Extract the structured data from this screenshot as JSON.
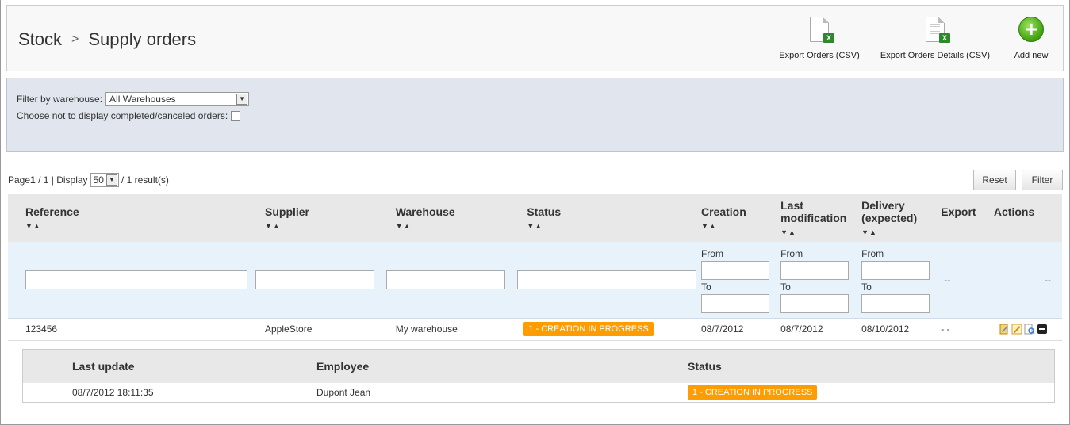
{
  "breadcrumb": {
    "parent": "Stock",
    "separator": ">",
    "current": "Supply orders"
  },
  "toolbar": {
    "export_orders": "Export Orders (CSV)",
    "export_details": "Export Orders Details (CSV)",
    "add_new": "Add new"
  },
  "filters": {
    "warehouse_label": "Filter by warehouse:",
    "warehouse_value": "All Warehouses",
    "hide_completed_label": "Choose not to display completed/canceled orders:"
  },
  "pagination": {
    "page_prefix": "Page",
    "current_page": "1",
    "page_suffix": "/ 1 | Display",
    "per_page": "50",
    "results": "/ 1 result(s)"
  },
  "buttons": {
    "reset": "Reset",
    "filter": "Filter"
  },
  "table": {
    "columns": {
      "reference": "Reference",
      "supplier": "Supplier",
      "warehouse": "Warehouse",
      "status": "Status",
      "creation": "Creation",
      "last_modification_1": "Last",
      "last_modification_2": "modification",
      "delivery_1": "Delivery",
      "delivery_2": "(expected)",
      "export": "Export",
      "actions": "Actions"
    },
    "sort_glyph": "▼▲",
    "date_from": "From",
    "date_to": "To",
    "empty_filter": "--",
    "row": {
      "reference": "123456",
      "supplier": "AppleStore",
      "warehouse": "My warehouse",
      "status": "1 - CREATION IN PROGRESS",
      "creation": "08/7/2012",
      "last_modification": "08/7/2012",
      "delivery": "08/10/2012",
      "export": "- -"
    }
  },
  "history": {
    "columns": {
      "last_update": "Last update",
      "employee": "Employee",
      "status": "Status"
    },
    "row": {
      "last_update": "08/7/2012 18:11:35",
      "employee": "Dupont Jean",
      "status": "1 - CREATION IN PROGRESS"
    }
  },
  "colors": {
    "status_badge": "#ff9c00",
    "filter_bg": "#e0e5ee",
    "add_icon": "#3fa010"
  },
  "icons": [
    "excel-export-icon",
    "add-circle-icon",
    "chevron-down-icon",
    "edit-icon",
    "view-icon",
    "collapse-icon"
  ]
}
